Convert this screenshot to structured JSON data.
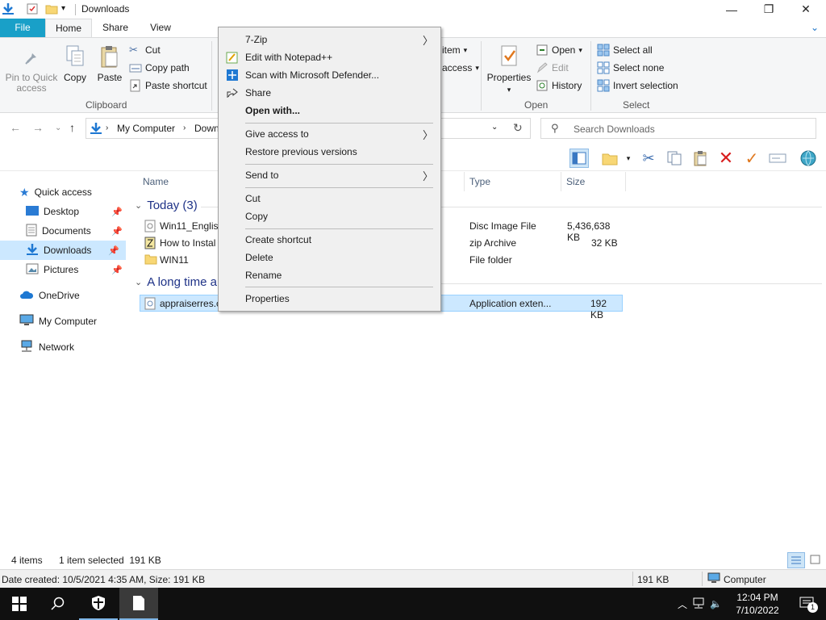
{
  "window": {
    "title": "Downloads"
  },
  "tabs": {
    "file": "File",
    "home": "Home",
    "share": "Share",
    "view": "View"
  },
  "ribbon": {
    "pin_quick_access": "Pin to Quick access",
    "copy": "Copy",
    "paste": "Paste",
    "cut": "Cut",
    "copy_path": "Copy path",
    "paste_shortcut": "Paste shortcut",
    "clipboard_group": "Clipboard",
    "new_item": "item",
    "easy_access": "access",
    "properties": "Properties",
    "open": "Open",
    "edit": "Edit",
    "history": "History",
    "open_group": "Open",
    "select_all": "Select all",
    "select_none": "Select none",
    "invert_selection": "Invert selection",
    "select_group": "Select"
  },
  "address": {
    "crumbs": [
      "My Computer",
      "Down"
    ],
    "search_placeholder": "Search Downloads"
  },
  "nav": {
    "quick_access": "Quick access",
    "desktop": "Desktop",
    "documents": "Documents",
    "downloads": "Downloads",
    "pictures": "Pictures",
    "onedrive": "OneDrive",
    "my_computer": "My Computer",
    "network": "Network"
  },
  "columns": {
    "name": "Name",
    "type": "Type",
    "size": "Size"
  },
  "groups": {
    "today": "Today (3)",
    "long_ago": "A long time a"
  },
  "files": [
    {
      "name": "Win11_English",
      "type": "Disc Image File",
      "size": "5,436,638 KB"
    },
    {
      "name": "How to Instal",
      "type": "zip Archive",
      "size": "32 KB"
    },
    {
      "name": "WIN11",
      "type": "File folder",
      "size": ""
    },
    {
      "name": "appraiserres.c",
      "type": "Application exten...",
      "size": "192 KB"
    }
  ],
  "context_menu": {
    "seven_zip": "7-Zip",
    "notepad": "Edit with Notepad++",
    "defender": "Scan with Microsoft Defender...",
    "share": "Share",
    "open_with": "Open with...",
    "give_access": "Give access to",
    "restore": "Restore previous versions",
    "send_to": "Send to",
    "cut": "Cut",
    "copy": "Copy",
    "create_shortcut": "Create shortcut",
    "delete": "Delete",
    "rename": "Rename",
    "properties": "Properties"
  },
  "status": {
    "items": "4 items",
    "selected": "1 item selected  191 KB"
  },
  "details": {
    "created": "Date created: 10/5/2021 4:35 AM, Size: 191 KB",
    "size": "191 KB",
    "location": "Computer"
  },
  "taskbar": {
    "time": "12:04 PM",
    "date": "7/10/2022",
    "notif_count": "1"
  },
  "colors": {
    "file_tab": "#19a0c8",
    "selection": "#cce8ff",
    "group_text": "#1e3287"
  }
}
